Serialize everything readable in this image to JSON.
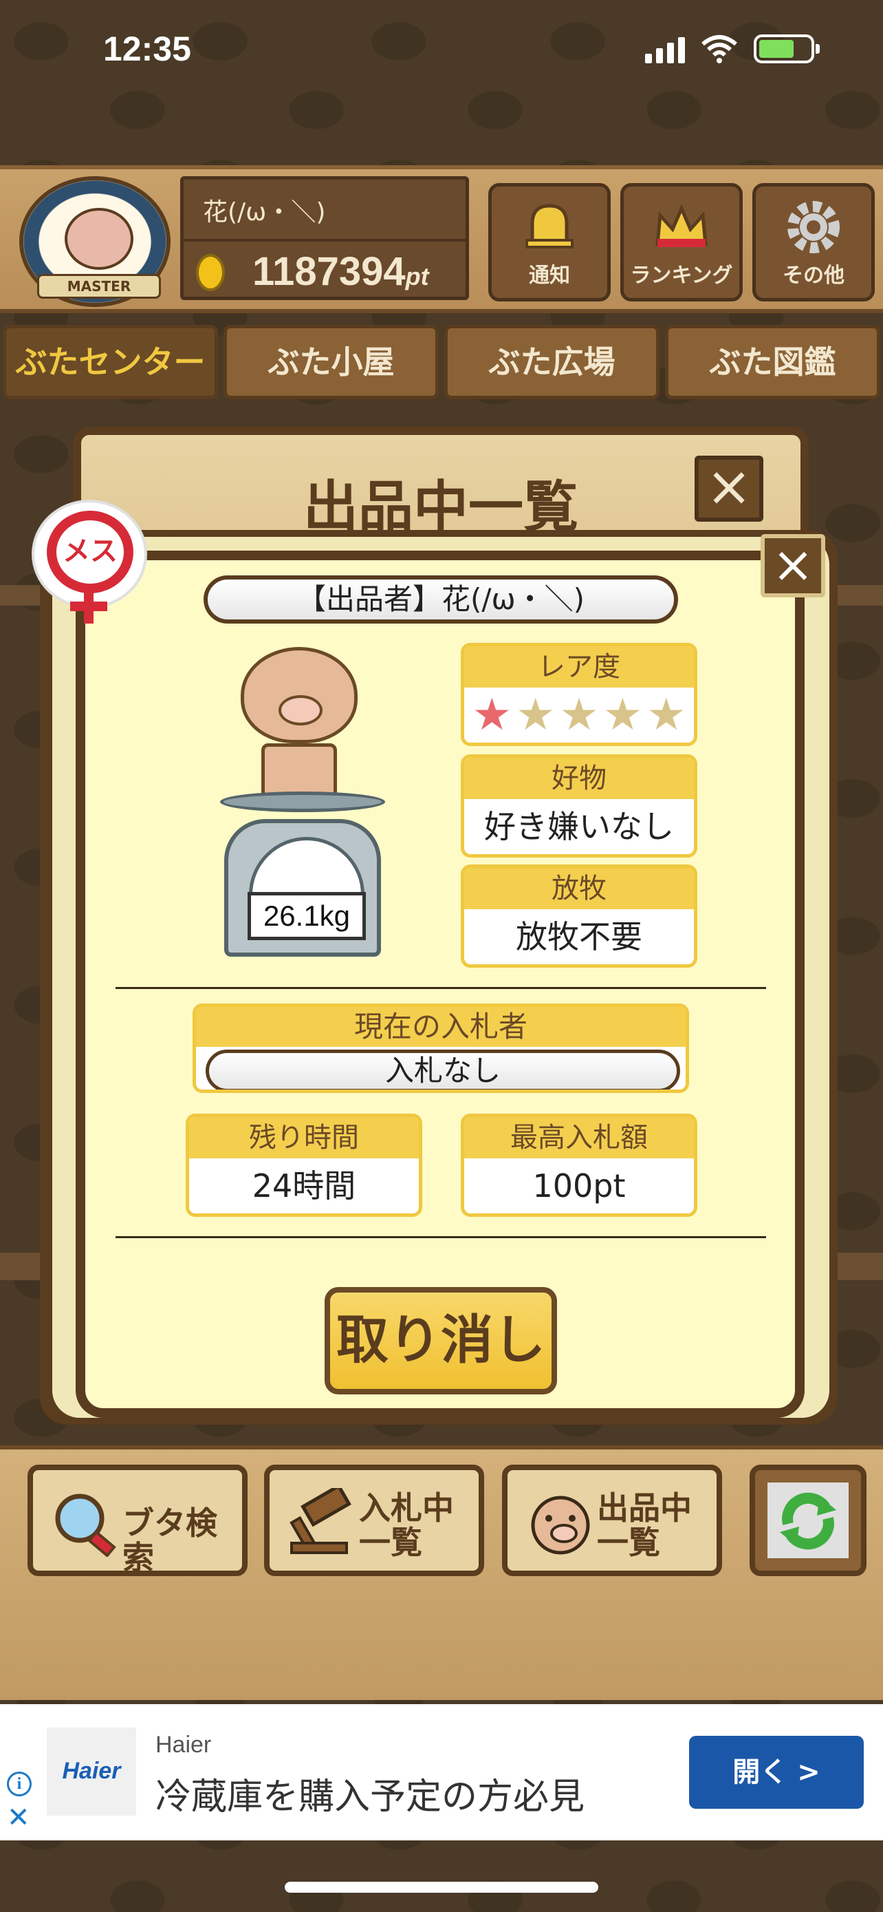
{
  "status_bar": {
    "time": "12:35"
  },
  "header": {
    "avatar_badge": "MASTER",
    "player_name": "花(/ω・＼)",
    "points": "1187394",
    "points_unit": "pt",
    "buttons": {
      "notify": "通知",
      "ranking": "ランキング",
      "other": "その他"
    }
  },
  "tabs": [
    "ぶたセンター",
    "ぶた小屋",
    "ぶた広場",
    "ぶた図鑑"
  ],
  "modal": {
    "title": "出品中一覧",
    "gender_label": "メス",
    "seller": "【出品者】花(/ω・＼)",
    "weight": "26.1kg",
    "rarity": {
      "label": "レア度",
      "stars_total": 5,
      "stars_filled": 1
    },
    "favorite": {
      "label": "好物",
      "value": "好き嫌いなし"
    },
    "grazing": {
      "label": "放牧",
      "value": "放牧不要"
    },
    "current_bidder": {
      "label": "現在の入札者",
      "value": "入札なし"
    },
    "remaining_time": {
      "label": "残り時間",
      "value": "24時間"
    },
    "highest_bid": {
      "label": "最高入札額",
      "value": "100pt"
    },
    "cancel_label": "取り消し"
  },
  "toolbar": {
    "search": "ブタ検索",
    "bidding_line1": "入札中",
    "bidding_line2": "一覧",
    "listing_line1": "出品中",
    "listing_line2": "一覧"
  },
  "ad": {
    "logo_text": "Haier",
    "brand": "Haier",
    "text": "冷蔵庫を購入予定の方必見",
    "button": "開く >",
    "info_glyph": "i",
    "close_glyph": "✕"
  },
  "colors": {
    "accent_yellow": "#f4cf4e",
    "wood_dark": "#5a3c1e",
    "card_bg": "#fefbc7",
    "star_on": "#e8686c",
    "ad_button": "#1b57a8"
  }
}
